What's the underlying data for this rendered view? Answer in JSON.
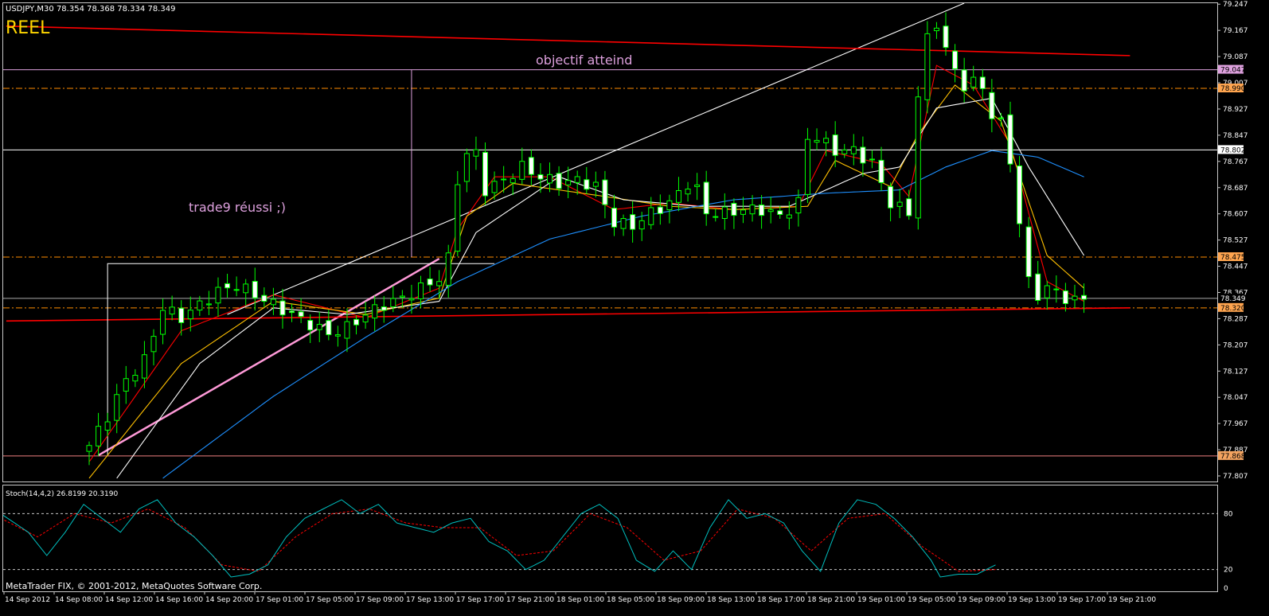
{
  "header": {
    "symbol_line": "USDJPY,M30  78.354 78.368 78.334 78.349",
    "account_label": "REEL"
  },
  "annotations": {
    "target": "objectif atteind",
    "trade": "trade9 réussi ;)"
  },
  "footer": {
    "copyright": "MetaTrader FIX, © 2001-2012, MetaQuotes Software Corp."
  },
  "stoch": {
    "label": "Stoch(14,4,2) 26.8199 20.3190",
    "levels": [
      80,
      20,
      0
    ],
    "level_labels": [
      "80",
      "20",
      "0"
    ]
  },
  "colors": {
    "background": "#000000",
    "bull_candle": "#00ff00",
    "bear_candle": "#ffffff",
    "ma_red": "#ff0000",
    "ma_orange": "#ffc000",
    "ma_white": "#ffffff",
    "ma_blue": "#1e90ff",
    "trendline_pink": "#ff9ad8",
    "stoch_main": "#00c0c0",
    "stoch_signal": "#ff0000",
    "level_dashdot": "#ff8c00",
    "hline_white": "#ffffff",
    "hline_lilac": "#dda0dd",
    "long_red": "#ff0000"
  },
  "chart_data": {
    "type": "candlestick",
    "price_axis": {
      "ticks": [
        "79.247",
        "79.167",
        "79.087",
        "79.007",
        "78.927",
        "78.847",
        "78.767",
        "78.687",
        "78.607",
        "78.527",
        "78.447",
        "78.367",
        "78.287",
        "78.207",
        "78.127",
        "78.047",
        "77.967",
        "77.887",
        "77.807"
      ],
      "ylim": [
        77.79,
        79.25
      ]
    },
    "time_axis": {
      "ticks": [
        "14 Sep 2012",
        "14 Sep 08:00",
        "14 Sep 12:00",
        "14 Sep 16:00",
        "14 Sep 20:00",
        "17 Sep 01:00",
        "17 Sep 05:00",
        "17 Sep 09:00",
        "17 Sep 13:00",
        "17 Sep 17:00",
        "17 Sep 21:00",
        "18 Sep 01:00",
        "18 Sep 05:00",
        "18 Sep 09:00",
        "18 Sep 13:00",
        "18 Sep 17:00",
        "18 Sep 21:00",
        "19 Sep 01:00",
        "19 Sep 05:00",
        "19 Sep 09:00",
        "19 Sep 13:00",
        "19 Sep 17:00",
        "19 Sep 21:00"
      ]
    },
    "price_levels": [
      {
        "value": 79.047,
        "label": "79.047",
        "style": "solid-lilac"
      },
      {
        "value": 78.99,
        "label": "78.990",
        "style": "dashdot-orange"
      },
      {
        "value": 78.802,
        "label": "78.802",
        "style": "solid-white"
      },
      {
        "value": 78.475,
        "label": "78.475",
        "style": "dashdot-orange"
      },
      {
        "value": 78.349,
        "label": "78.349",
        "style": "current"
      },
      {
        "value": 78.32,
        "label": "78.320",
        "style": "dashdot-orange"
      },
      {
        "value": 77.868,
        "label": "77.868",
        "style": "solid-salmon"
      }
    ],
    "close_anchors": [
      [
        0,
        77.9
      ],
      [
        2,
        77.99
      ],
      [
        4,
        78.1
      ],
      [
        6,
        78.16
      ],
      [
        8,
        78.32
      ],
      [
        10,
        78.29
      ],
      [
        12,
        78.33
      ],
      [
        14,
        78.37
      ],
      [
        16,
        78.39
      ],
      [
        18,
        78.36
      ],
      [
        20,
        78.33
      ],
      [
        22,
        78.3
      ],
      [
        24,
        78.27
      ],
      [
        26,
        78.24
      ],
      [
        28,
        78.26
      ],
      [
        30,
        78.3
      ],
      [
        32,
        78.33
      ],
      [
        34,
        78.35
      ],
      [
        36,
        78.38
      ],
      [
        38,
        78.41
      ],
      [
        39,
        78.47
      ],
      [
        40,
        78.71
      ],
      [
        41,
        78.79
      ],
      [
        42,
        78.79
      ],
      [
        43,
        78.68
      ],
      [
        45,
        78.71
      ],
      [
        47,
        78.75
      ],
      [
        49,
        78.72
      ],
      [
        51,
        78.7
      ],
      [
        53,
        78.71
      ],
      [
        55,
        78.69
      ],
      [
        57,
        78.58
      ],
      [
        59,
        78.57
      ],
      [
        61,
        78.61
      ],
      [
        63,
        78.64
      ],
      [
        65,
        78.7
      ],
      [
        66,
        78.68
      ],
      [
        67,
        78.61
      ],
      [
        69,
        78.61
      ],
      [
        71,
        78.62
      ],
      [
        73,
        78.62
      ],
      [
        75,
        78.6
      ],
      [
        77,
        78.64
      ],
      [
        78,
        78.84
      ],
      [
        79,
        78.84
      ],
      [
        81,
        78.8
      ],
      [
        83,
        78.8
      ],
      [
        85,
        78.76
      ],
      [
        87,
        78.64
      ],
      [
        89,
        78.61
      ],
      [
        90,
        78.97
      ],
      [
        91,
        79.14
      ],
      [
        92,
        79.19
      ],
      [
        93,
        79.11
      ],
      [
        94,
        79.04
      ],
      [
        95,
        79.0
      ],
      [
        96,
        79.01
      ],
      [
        97,
        78.99
      ],
      [
        98,
        78.91
      ],
      [
        99,
        78.88
      ],
      [
        100,
        78.77
      ],
      [
        101,
        78.58
      ],
      [
        102,
        78.4
      ],
      [
        103,
        78.36
      ],
      [
        104,
        78.38
      ],
      [
        105,
        78.37
      ],
      [
        106,
        78.35
      ],
      [
        107,
        78.34
      ],
      [
        108,
        78.35
      ]
    ],
    "moving_averages": [
      {
        "color": "red",
        "points": [
          [
            0,
            77.85
          ],
          [
            10,
            78.25
          ],
          [
            20,
            78.36
          ],
          [
            30,
            78.29
          ],
          [
            38,
            78.38
          ],
          [
            40,
            78.56
          ],
          [
            44,
            78.72
          ],
          [
            50,
            78.72
          ],
          [
            57,
            78.62
          ],
          [
            63,
            78.64
          ],
          [
            70,
            78.62
          ],
          [
            77,
            78.63
          ],
          [
            80,
            78.8
          ],
          [
            86,
            78.76
          ],
          [
            89,
            78.66
          ],
          [
            92,
            79.06
          ],
          [
            96,
            79.0
          ],
          [
            100,
            78.82
          ],
          [
            104,
            78.4
          ],
          [
            108,
            78.34
          ]
        ]
      },
      {
        "color": "orange",
        "points": [
          [
            0,
            77.8
          ],
          [
            10,
            78.15
          ],
          [
            20,
            78.34
          ],
          [
            30,
            78.3
          ],
          [
            38,
            78.35
          ],
          [
            41,
            78.6
          ],
          [
            46,
            78.7
          ],
          [
            56,
            78.66
          ],
          [
            63,
            78.63
          ],
          [
            70,
            78.62
          ],
          [
            78,
            78.63
          ],
          [
            81,
            78.77
          ],
          [
            87,
            78.69
          ],
          [
            90,
            78.85
          ],
          [
            94,
            79.0
          ],
          [
            99,
            78.89
          ],
          [
            104,
            78.48
          ],
          [
            108,
            78.38
          ]
        ]
      },
      {
        "color": "white",
        "points": [
          [
            3,
            77.8
          ],
          [
            12,
            78.15
          ],
          [
            20,
            78.32
          ],
          [
            28,
            78.3
          ],
          [
            38,
            78.34
          ],
          [
            42,
            78.55
          ],
          [
            51,
            78.72
          ],
          [
            58,
            78.65
          ],
          [
            66,
            78.63
          ],
          [
            76,
            78.63
          ],
          [
            84,
            78.73
          ],
          [
            88,
            78.75
          ],
          [
            92,
            78.93
          ],
          [
            98,
            78.96
          ],
          [
            102,
            78.75
          ],
          [
            108,
            78.48
          ]
        ]
      },
      {
        "color": "blue",
        "points": [
          [
            8,
            77.8
          ],
          [
            20,
            78.05
          ],
          [
            30,
            78.23
          ],
          [
            40,
            78.4
          ],
          [
            50,
            78.53
          ],
          [
            60,
            78.6
          ],
          [
            70,
            78.65
          ],
          [
            80,
            78.67
          ],
          [
            88,
            78.68
          ],
          [
            93,
            78.75
          ],
          [
            98,
            78.8
          ],
          [
            103,
            78.78
          ],
          [
            108,
            78.72
          ]
        ]
      }
    ],
    "trendlines": [
      {
        "color": "pink",
        "from": [
          1,
          77.87
        ],
        "to": [
          38,
          78.47
        ]
      },
      {
        "color": "white",
        "from": [
          15,
          78.3
        ],
        "to": [
          95,
          79.25
        ]
      },
      {
        "color": "red",
        "from": [
          -9,
          79.18
        ],
        "to": [
          113,
          79.09
        ]
      },
      {
        "color": "red",
        "from": [
          -9,
          78.28
        ],
        "to": [
          113,
          78.32
        ]
      }
    ],
    "stochastic": {
      "main_anchors": [
        [
          0,
          80
        ],
        [
          3,
          60
        ],
        [
          5,
          35
        ],
        [
          7,
          60
        ],
        [
          9,
          90
        ],
        [
          11,
          75
        ],
        [
          13,
          60
        ],
        [
          15,
          85
        ],
        [
          17,
          95
        ],
        [
          19,
          70
        ],
        [
          21,
          55
        ],
        [
          23,
          35
        ],
        [
          25,
          12
        ],
        [
          27,
          15
        ],
        [
          29,
          25
        ],
        [
          31,
          55
        ],
        [
          33,
          75
        ],
        [
          35,
          85
        ],
        [
          37,
          95
        ],
        [
          39,
          80
        ],
        [
          41,
          90
        ],
        [
          43,
          70
        ],
        [
          45,
          65
        ],
        [
          47,
          60
        ],
        [
          49,
          70
        ],
        [
          51,
          75
        ],
        [
          53,
          50
        ],
        [
          55,
          40
        ],
        [
          57,
          20
        ],
        [
          59,
          30
        ],
        [
          61,
          55
        ],
        [
          63,
          80
        ],
        [
          65,
          90
        ],
        [
          67,
          75
        ],
        [
          69,
          30
        ],
        [
          71,
          18
        ],
        [
          73,
          40
        ],
        [
          75,
          20
        ],
        [
          77,
          65
        ],
        [
          79,
          95
        ],
        [
          81,
          75
        ],
        [
          83,
          80
        ],
        [
          85,
          70
        ],
        [
          87,
          40
        ],
        [
          89,
          18
        ],
        [
          91,
          70
        ],
        [
          93,
          95
        ],
        [
          95,
          90
        ],
        [
          97,
          75
        ],
        [
          99,
          55
        ],
        [
          101,
          30
        ],
        [
          102,
          12
        ],
        [
          104,
          15
        ],
        [
          106,
          15
        ],
        [
          107,
          20
        ],
        [
          108,
          25
        ]
      ],
      "signal_anchors": [
        [
          0,
          75
        ],
        [
          4,
          55
        ],
        [
          8,
          80
        ],
        [
          12,
          70
        ],
        [
          16,
          85
        ],
        [
          20,
          65
        ],
        [
          24,
          25
        ],
        [
          28,
          18
        ],
        [
          32,
          55
        ],
        [
          36,
          80
        ],
        [
          40,
          85
        ],
        [
          44,
          70
        ],
        [
          48,
          65
        ],
        [
          52,
          65
        ],
        [
          56,
          35
        ],
        [
          60,
          40
        ],
        [
          64,
          80
        ],
        [
          68,
          65
        ],
        [
          72,
          30
        ],
        [
          76,
          40
        ],
        [
          80,
          85
        ],
        [
          84,
          75
        ],
        [
          88,
          40
        ],
        [
          92,
          75
        ],
        [
          96,
          80
        ],
        [
          100,
          45
        ],
        [
          104,
          18
        ],
        [
          108,
          20
        ]
      ]
    }
  }
}
